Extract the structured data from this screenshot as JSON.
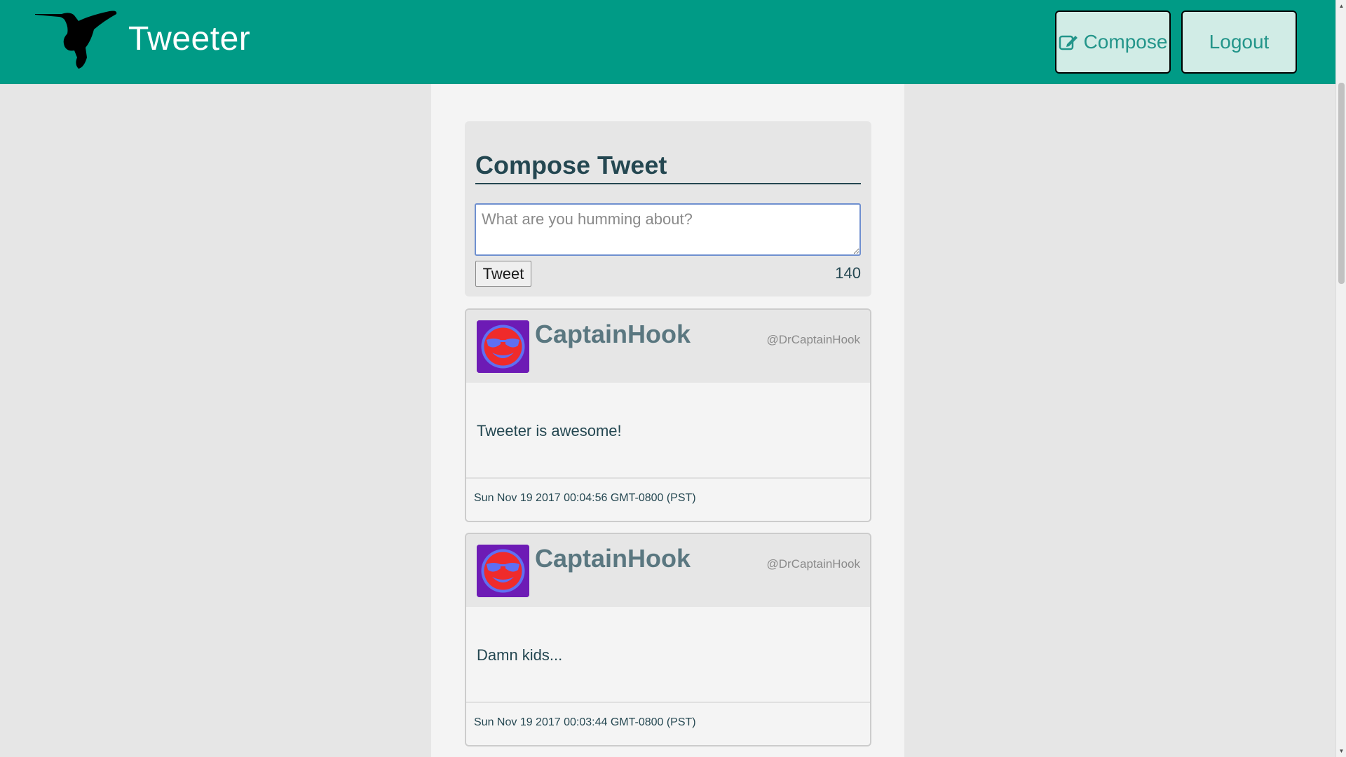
{
  "header": {
    "brand": "Tweeter",
    "compose_label": "Compose",
    "logout_label": "Logout",
    "bg_color": "#009b86"
  },
  "compose": {
    "title": "Compose Tweet",
    "placeholder": "What are you humming about?",
    "tweet_button": "Tweet",
    "char_count": "140"
  },
  "tweets": [
    {
      "name": "CaptainHook",
      "handle": "@DrCaptainHook",
      "body": "Tweeter is awesome!",
      "date": "Sun Nov 19 2017 00:04:56 GMT-0800 (PST)",
      "avatar_icon": "smiley-sunglasses-avatar"
    },
    {
      "name": "CaptainHook",
      "handle": "@DrCaptainHook",
      "body": "Damn kids...",
      "date": "Sun Nov 19 2017 00:03:44 GMT-0800 (PST)",
      "avatar_icon": "smiley-sunglasses-avatar"
    }
  ]
}
